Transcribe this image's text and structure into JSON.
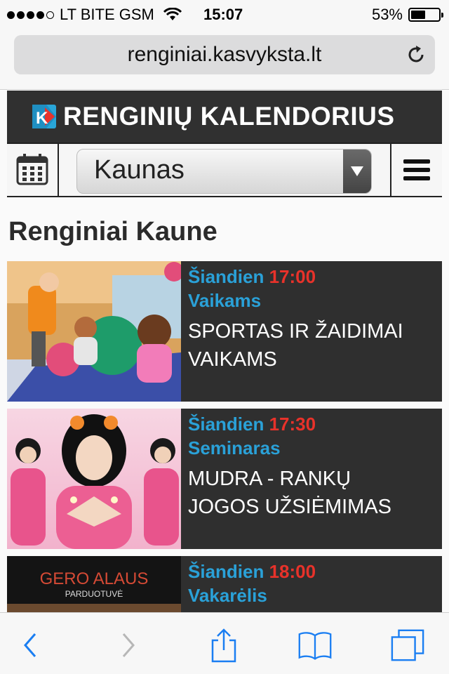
{
  "status_bar": {
    "carrier": "LT BITE GSM",
    "signal_bars_filled": 4,
    "signal_bars_total": 5,
    "time": "15:07",
    "battery_percent_text": "53%",
    "battery_level": 0.53,
    "wifi_icon": "wifi-icon"
  },
  "browser": {
    "url": "renginiai.kasvyksta.lt",
    "reload_icon": "reload-icon",
    "toolbar_icons": [
      "back-icon",
      "forward-icon",
      "share-icon",
      "bookmarks-icon",
      "tabs-icon"
    ]
  },
  "site": {
    "title": "RENGINIŲ KALENDORIUS",
    "logo_letter": "K",
    "calendar_icon": "calendar-icon",
    "menu_icon": "hamburger-menu-icon",
    "city": "Kaunas",
    "section_title": "Renginiai Kaune"
  },
  "events": [
    {
      "day": "Šiandien",
      "time": "17:00",
      "category": "Vaikams",
      "title_line1": "SPORTAS IR ŽAIDIMAI",
      "title_line2": "VAIKAMS",
      "image": "children-playing-gym-balls"
    },
    {
      "day": "Šiandien",
      "time": "17:30",
      "category": "Seminaras",
      "title_line1": "MUDRA - RANKŲ",
      "title_line2": "JOGOS UŽSIĖMIMAS",
      "image": "woman-yoga-hands-pink"
    },
    {
      "day": "Šiandien",
      "time": "18:00",
      "category": "Vakarėlis",
      "title_line1": "",
      "title_line2": "",
      "image": "beer-shop-sign",
      "image_text_1": "GERO ALAUS",
      "image_text_2": "PARDUOTUVĖ"
    }
  ],
  "colors": {
    "header_bg": "#303030",
    "accent_blue": "#2aa1d8",
    "time_red": "#e8322a",
    "ios_blue": "#1a7ef2"
  }
}
